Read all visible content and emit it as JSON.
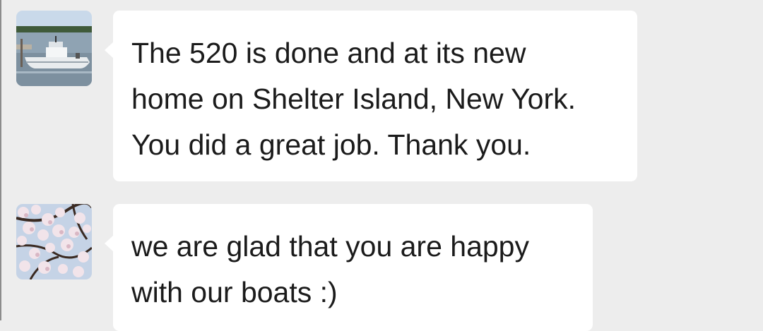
{
  "conversation": {
    "messages": [
      {
        "avatar_icon": "boat-photo-avatar",
        "text": "The 520 is done and at its new\nhome on Shelter Island, New York.\nYou did a great job. Thank you."
      },
      {
        "avatar_icon": "cherry-blossom-photo-avatar",
        "text": "we are glad that you are happy\nwith our boats :)"
      }
    ]
  },
  "colors": {
    "background": "#ededed",
    "bubble": "#ffffff",
    "text": "#1b1b1b"
  }
}
